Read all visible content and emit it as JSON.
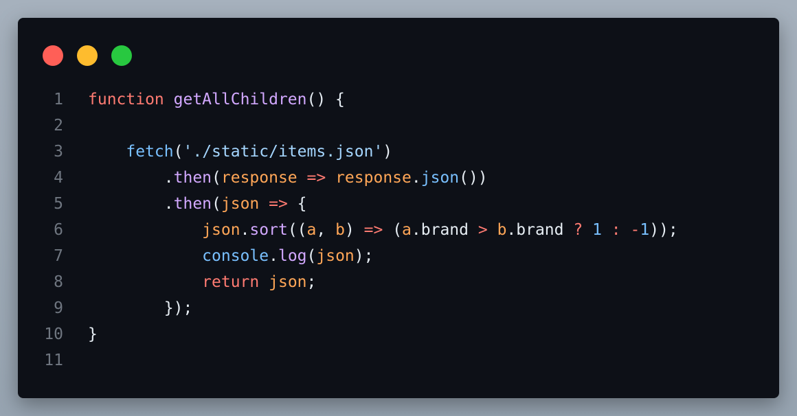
{
  "window": {
    "buttons": {
      "close_color": "#ff5f57",
      "minimize_color": "#febc2e",
      "maximize_color": "#28c840"
    }
  },
  "code": {
    "line_numbers": [
      "1",
      "2",
      "3",
      "4",
      "5",
      "6",
      "7",
      "8",
      "9",
      "10",
      "11"
    ],
    "tokens": {
      "l1": [
        "function",
        " ",
        "getAllChildren",
        "() {"
      ],
      "l3": [
        "    ",
        "fetch",
        "(",
        "'./static/items.json'",
        ")"
      ],
      "l4": [
        "        .",
        "then",
        "(",
        "response",
        " ",
        "=>",
        " ",
        "response",
        ".",
        "json",
        "())"
      ],
      "l5": [
        "        .",
        "then",
        "(",
        "json",
        " ",
        "=>",
        " {"
      ],
      "l6": [
        "            ",
        "json",
        ".",
        "sort",
        "((",
        "a",
        ", ",
        "b",
        ") ",
        "=>",
        " (",
        "a",
        ".brand ",
        ">",
        " ",
        "b",
        ".brand ",
        "?",
        " ",
        "1",
        " ",
        ":",
        " ",
        "-",
        "1",
        "));"
      ],
      "l7": [
        "            ",
        "console",
        ".",
        "log",
        "(",
        "json",
        ");"
      ],
      "l8": [
        "            ",
        "return",
        " ",
        "json",
        ";"
      ],
      "l9": [
        "        });"
      ],
      "l10": [
        "}"
      ]
    }
  }
}
